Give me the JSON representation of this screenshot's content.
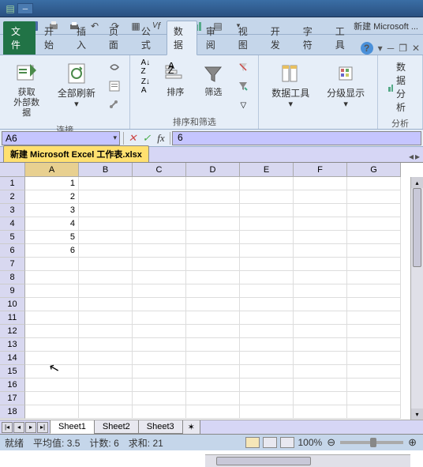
{
  "app": {
    "title_suffix": "新建 Microsoft ..."
  },
  "tabs": {
    "file": "文件",
    "items": [
      "开始",
      "插入",
      "页面",
      "公式",
      "数据",
      "审阅",
      "视图",
      "开发",
      "字符",
      "工具"
    ],
    "active_index": 4
  },
  "ribbon": {
    "data_analysis_btn": "数据分析",
    "group1": {
      "btn1": "获取\n外部数据",
      "btn2": "全部刷新",
      "label": "连接"
    },
    "group2": {
      "sort": "排序",
      "filter": "筛选",
      "label": "排序和筛选"
    },
    "group3": {
      "tools": "数据工具",
      "outline": "分级显示"
    },
    "group4": {
      "label": "分析"
    }
  },
  "formula_bar": {
    "name": "A6",
    "fx": "fx",
    "formula": "6"
  },
  "workbook_tab": "新建 Microsoft Excel 工作表.xlsx",
  "columns": [
    "A",
    "B",
    "C",
    "D",
    "E",
    "F",
    "G"
  ],
  "rows": 18,
  "cells": {
    "A1": "1",
    "A2": "2",
    "A3": "3",
    "A4": "4",
    "A5": "5",
    "A6": "6"
  },
  "sheets": {
    "items": [
      "Sheet1",
      "Sheet2",
      "Sheet3"
    ],
    "active": 0
  },
  "status": {
    "ready": "就绪",
    "avg_label": "平均值:",
    "avg": "3.5",
    "count_label": "计数:",
    "count": "6",
    "sum_label": "求和:",
    "sum": "21",
    "zoom": "100%"
  }
}
